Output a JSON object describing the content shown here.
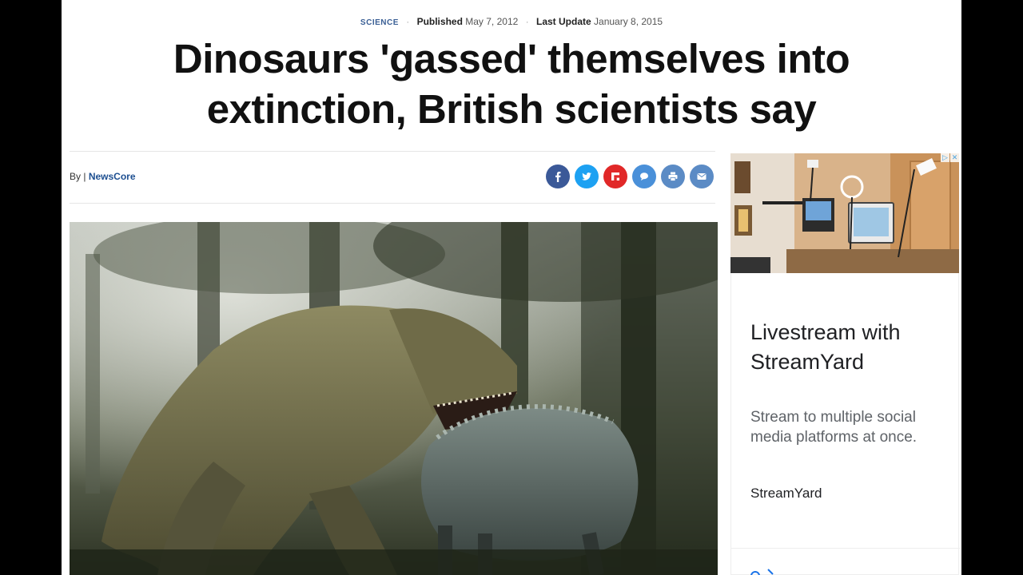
{
  "article": {
    "category": "SCIENCE",
    "published_label": "Published",
    "published_date": "May 7, 2012",
    "updated_label": "Last Update",
    "updated_date": "January 8, 2015",
    "headline_line1": "Dinosaurs 'gassed' themselves into",
    "headline_line2": "extinction, British scientists say",
    "byline_prefix": "By |",
    "author": "NewsCore"
  },
  "share_buttons": [
    {
      "name": "facebook-share-button",
      "icon": "facebook-icon",
      "color": "#3b5998"
    },
    {
      "name": "twitter-share-button",
      "icon": "twitter-icon",
      "color": "#1da1f2"
    },
    {
      "name": "flipboard-share-button",
      "icon": "flipboard-icon",
      "color": "#e12828"
    },
    {
      "name": "comment-button",
      "icon": "comment-icon",
      "color": "#4a90d9"
    },
    {
      "name": "print-button",
      "icon": "print-icon",
      "color": "#5b8bc5"
    },
    {
      "name": "email-share-button",
      "icon": "email-icon",
      "color": "#5b8bc5"
    }
  ],
  "ad": {
    "title": "Livestream with StreamYard",
    "description": "Stream to multiple social media platforms at once.",
    "brand": "StreamYard"
  },
  "colors": {
    "category": "#3a5f95",
    "author_link": "#1d4f91"
  }
}
